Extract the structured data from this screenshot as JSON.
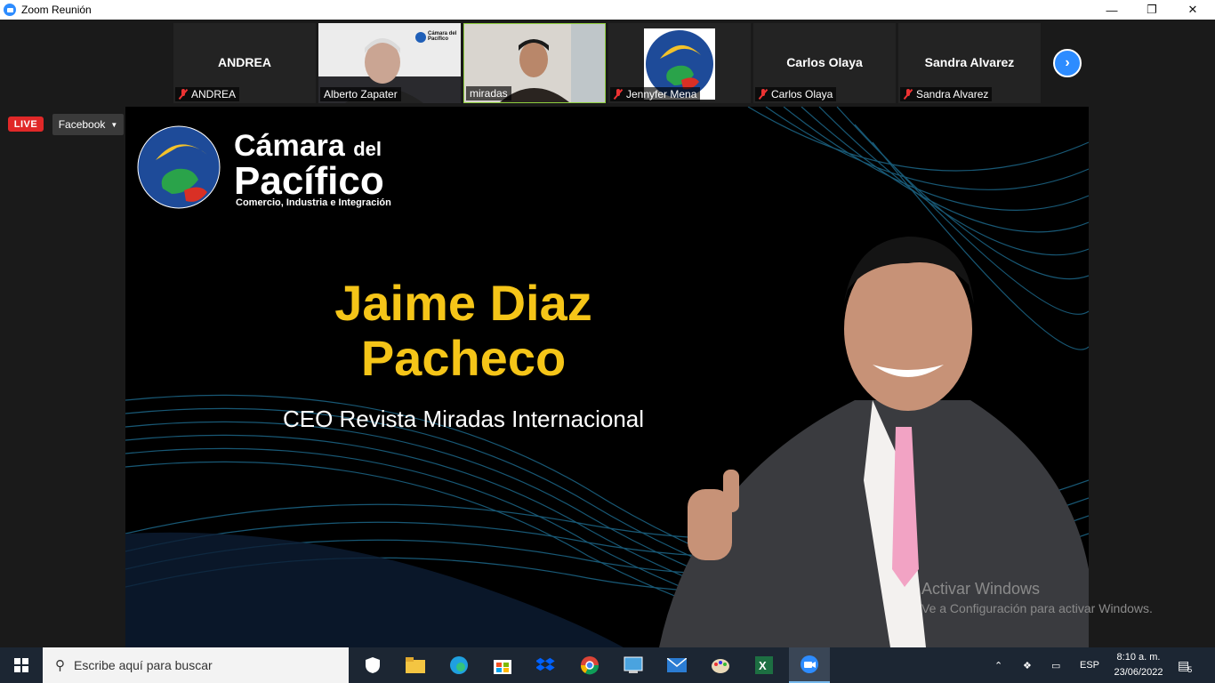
{
  "window": {
    "title": "Zoom Reunión",
    "minimize": "—",
    "maximize": "❐",
    "close": "✕"
  },
  "participants": [
    {
      "big_name": "ANDREA",
      "label": "ANDREA",
      "muted": true,
      "video": false
    },
    {
      "big_name": "",
      "label": "Alberto Zapater",
      "muted": false,
      "video": true
    },
    {
      "big_name": "",
      "label": "miradas",
      "muted": false,
      "video": true
    },
    {
      "big_name": "",
      "label": "Jennyfer Mena",
      "muted": true,
      "video": false
    },
    {
      "big_name": "Carlos Olaya",
      "label": "Carlos Olaya",
      "muted": true,
      "video": false
    },
    {
      "big_name": "Sandra Alvarez",
      "label": "Sandra Alvarez",
      "muted": true,
      "video": false
    }
  ],
  "small_logo_text": {
    "line1": "Cámara del",
    "line2": "Pacífico"
  },
  "live_badge": "LIVE",
  "live_target": "Facebook",
  "slide": {
    "brand_line1": "Cámara",
    "brand_line1_small": "del",
    "brand_line2": "Pacífico",
    "brand_tagline": "Comercio, Industria e Integración",
    "speaker_name_line1": "Jaime Diaz",
    "speaker_name_line2": "Pacheco",
    "speaker_role": "CEO Revista Miradas Internacional"
  },
  "watermark": {
    "line1": "Activar Windows",
    "line2": "Ve a Configuración para activar Windows."
  },
  "taskbar": {
    "search_placeholder": "Escribe aquí para buscar",
    "language": "ESP",
    "time": "8:10 a. m.",
    "date": "23/06/2022",
    "notifications": "5"
  },
  "colors": {
    "accent": "#2d8cff",
    "live": "#e02828",
    "speaker_name": "#f5c518",
    "taskbar": "#1c2633"
  }
}
